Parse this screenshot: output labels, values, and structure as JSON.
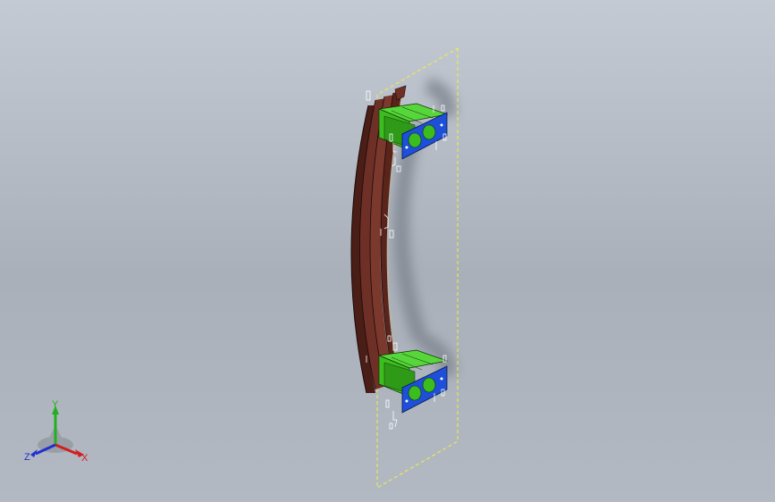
{
  "triad": {
    "x_label": "X",
    "y_label": "Y",
    "z_label": "Z"
  },
  "colors": {
    "background_top": "#c4cad3",
    "background_bottom": "#a9b0ba",
    "rail": "#6e3026",
    "rail_dark": "#4a1d16",
    "bracket_green": "#3bbd1f",
    "plate_blue": "#1d4fd8",
    "sketch_plane": "#f2f23a",
    "axis_x": "#d02020",
    "axis_y": "#20b020",
    "axis_z": "#2030d0"
  }
}
